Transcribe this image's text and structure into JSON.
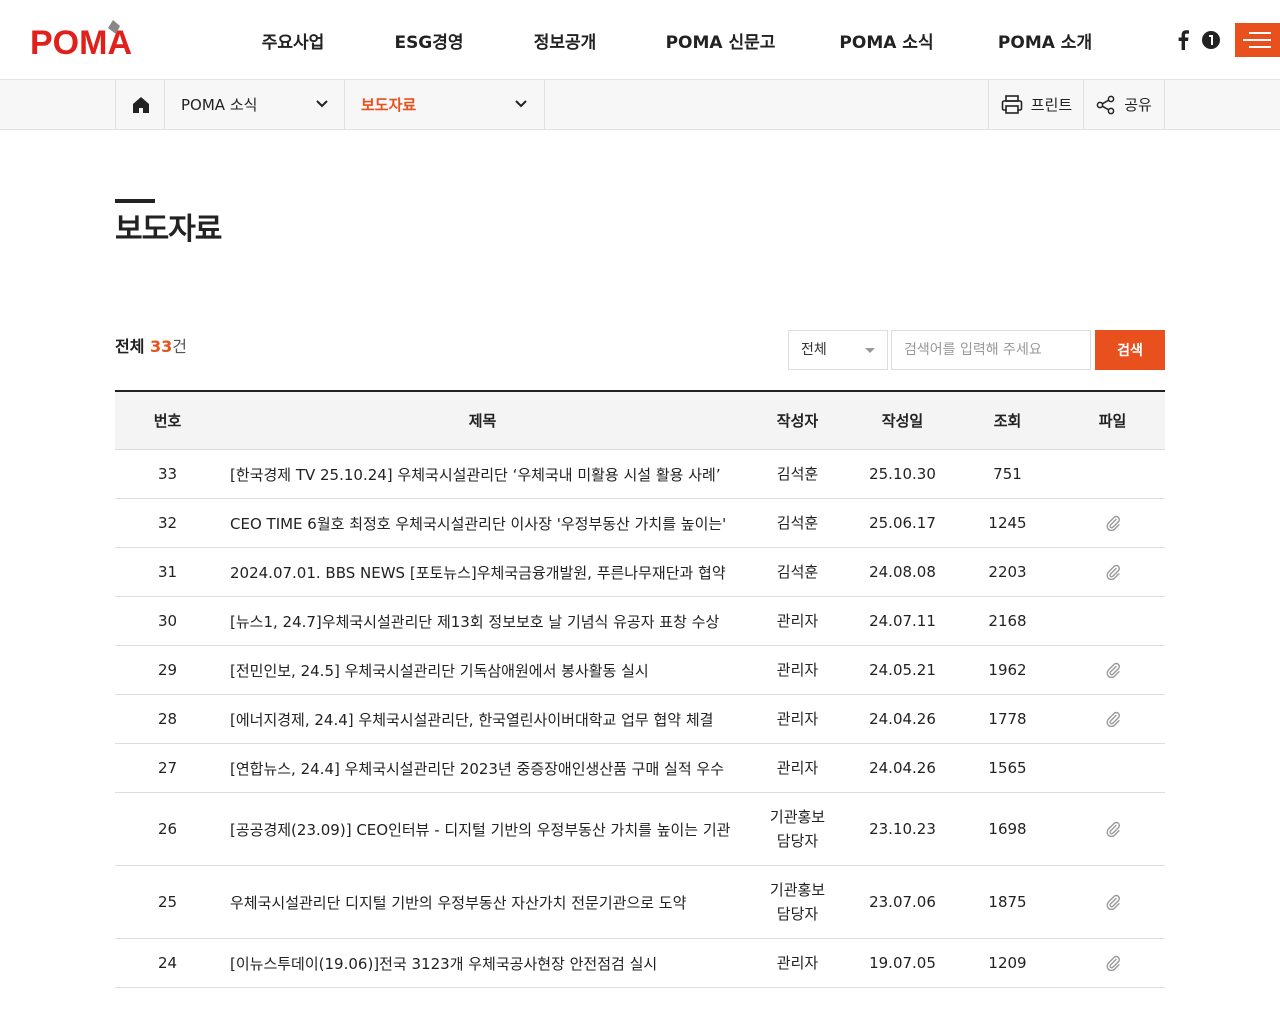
{
  "header": {
    "logo_text": "POMA",
    "nav": [
      "주요사업",
      "ESG경영",
      "정보공개",
      "POMA 신문고",
      "POMA 소식",
      "POMA 소개"
    ],
    "colors": {
      "accent": "#e8501d"
    }
  },
  "subnav": {
    "depth1": "POMA 소식",
    "depth2": "보도자료",
    "print_label": "프린트",
    "share_label": "공유"
  },
  "page": {
    "title": "보도자료"
  },
  "list": {
    "total_label": "전체",
    "total_count": "33",
    "total_unit": "건"
  },
  "search": {
    "select_value": "전체",
    "placeholder": "검색어를 입력해 주세요",
    "button_label": "검색"
  },
  "table": {
    "headers": {
      "no": "번호",
      "title": "제목",
      "author": "작성자",
      "date": "작성일",
      "views": "조회",
      "file": "파일"
    },
    "rows": [
      {
        "no": "33",
        "title": "[한국경제 TV 25.10.24] 우체국시설관리단 ‘우체국내 미활용 시설 활용 사례’",
        "author": "김석훈",
        "date": "25.10.30",
        "views": "751",
        "has_file": false
      },
      {
        "no": "32",
        "title": "CEO TIME 6월호 최정호 우체국시설관리단 이사장 '우정부동산 가치를 높이는'",
        "author": "김석훈",
        "date": "25.06.17",
        "views": "1245",
        "has_file": true
      },
      {
        "no": "31",
        "title": "2024.07.01. BBS NEWS [포토뉴스]우체국금융개발원, 푸른나무재단과 협약",
        "author": "김석훈",
        "date": "24.08.08",
        "views": "2203",
        "has_file": true
      },
      {
        "no": "30",
        "title": "[뉴스1, 24.7]우체국시설관리단 제13회 정보보호 날 기념식 유공자 표창 수상",
        "author": "관리자",
        "date": "24.07.11",
        "views": "2168",
        "has_file": false
      },
      {
        "no": "29",
        "title": "[전민인보, 24.5] 우체국시설관리단 기독삼애원에서 봉사활동 실시",
        "author": "관리자",
        "date": "24.05.21",
        "views": "1962",
        "has_file": true
      },
      {
        "no": "28",
        "title": "[에너지경제, 24.4] 우체국시설관리단, 한국열린사이버대학교 업무 협약 체결",
        "author": "관리자",
        "date": "24.04.26",
        "views": "1778",
        "has_file": true
      },
      {
        "no": "27",
        "title": "[연합뉴스, 24.4] 우체국시설관리단 2023년 중증장애인생산품 구매 실적 우수",
        "author": "관리자",
        "date": "24.04.26",
        "views": "1565",
        "has_file": false
      },
      {
        "no": "26",
        "title": "[공공경제(23.09)] CEO인터뷰 - 디지털 기반의 우정부동산 가치를 높이는 기관",
        "author": "기관홍보담당자",
        "date": "23.10.23",
        "views": "1698",
        "has_file": true
      },
      {
        "no": "25",
        "title": "우체국시설관리단 디지털 기반의 우정부동산 자산가치 전문기관으로 도약",
        "author": "기관홍보담당자",
        "date": "23.07.06",
        "views": "1875",
        "has_file": true
      },
      {
        "no": "24",
        "title": "[이뉴스투데이(19.06)]전국 3123개 우체국공사현장 안전점검 실시",
        "author": "관리자",
        "date": "19.07.05",
        "views": "1209",
        "has_file": true
      }
    ]
  }
}
